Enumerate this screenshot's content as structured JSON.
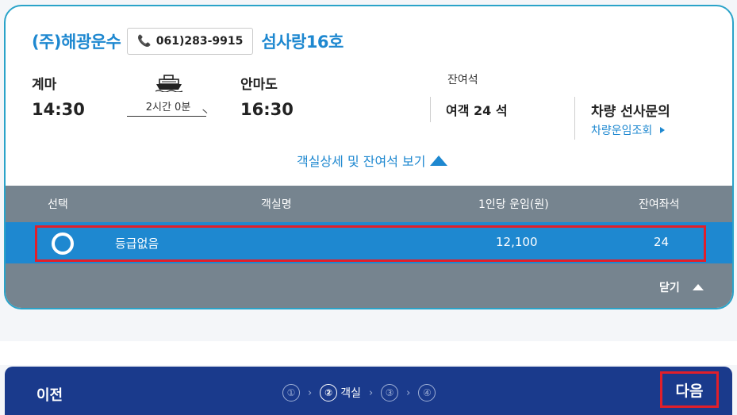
{
  "schedule": {
    "company": "(주)해광운수",
    "phone": "061)283-9915",
    "ship_name": "섬사랑16호",
    "departure_port": "계마",
    "departure_time": "14:30",
    "duration": "2시간 0분",
    "arrival_port": "안마도",
    "arrival_time": "16:30",
    "remaining_seats_label": "잔여석",
    "passenger_seats": "여객 24 석",
    "vehicle_label": "차량 선사문의",
    "vehicle_link": "차량운임조회",
    "detail_toggle": "객실상세 및 잔여석 보기"
  },
  "cabin_table": {
    "headers": {
      "select": "선택",
      "cabin_name": "객실명",
      "fare": "1인당 운임(원)",
      "remaining": "잔여좌석"
    },
    "rows": [
      {
        "cabin_name": "등급없음",
        "fare": "12,100",
        "remaining": "24",
        "selected": true
      }
    ],
    "close_label": "닫기"
  },
  "bottom_nav": {
    "prev_label": "이전",
    "steps": [
      "①",
      "②",
      "③",
      "④"
    ],
    "current_step_label": "객실",
    "next_label": "다음"
  },
  "colors": {
    "accent": "#1e88d0",
    "table_header": "#76848f",
    "nav_bar": "#1a3a8c",
    "highlight": "#e11f2a",
    "card_border": "#2aa3c9"
  }
}
